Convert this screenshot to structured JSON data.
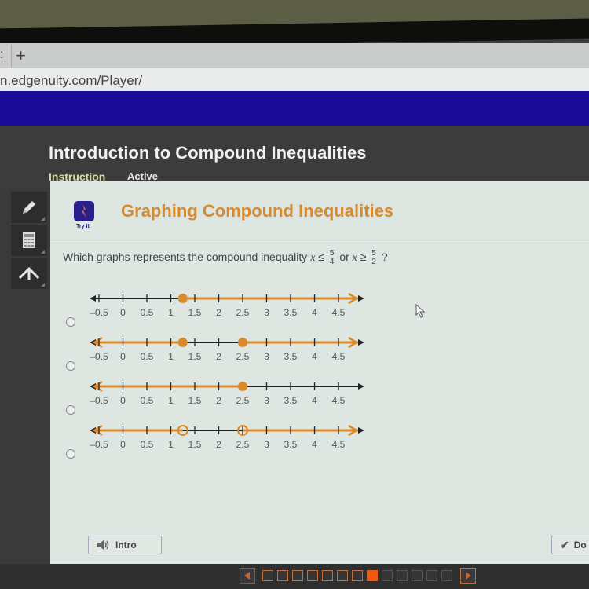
{
  "browser": {
    "tab_partial": ":",
    "new_tab_symbol": "+",
    "url": "n.edgenuity.com/Player/"
  },
  "header": {
    "lesson_title": "Introduction to Compound Inequalities",
    "tabs": [
      {
        "label": "Instruction",
        "active": true
      },
      {
        "label": "Active",
        "active": false
      }
    ]
  },
  "toolbar": {
    "tools": [
      {
        "name": "pencil-icon"
      },
      {
        "name": "calculator-icon"
      },
      {
        "name": "reference-icon"
      }
    ]
  },
  "content": {
    "tryit_label": "Try It",
    "section_title": "Graphing Compound Inequalities",
    "question": {
      "prefix": "Which graphs represents the compound inequality",
      "var1": "x",
      "op1": "≤",
      "frac1_num": "5",
      "frac1_den": "4",
      "connector": "or",
      "var2": "x",
      "op2": "≥",
      "frac2_num": "5",
      "frac2_den": "2",
      "suffix": "?"
    },
    "tick_labels": [
      "–0.5",
      "0",
      "0.5",
      "1",
      "1.5",
      "2",
      "2.5",
      "3",
      "3.5",
      "4",
      "4.5"
    ],
    "options": [
      {
        "id": "A",
        "selected": false,
        "points": [
          {
            "value": 1.25,
            "closed": true
          }
        ],
        "shaded": [
          {
            "from": 1.25,
            "to": "inf"
          }
        ]
      },
      {
        "id": "B",
        "selected": false,
        "points": [
          {
            "value": 1.25,
            "closed": true
          },
          {
            "value": 2.5,
            "closed": true
          }
        ],
        "shaded": [
          {
            "from": "-inf",
            "to": 1.25
          },
          {
            "from": 2.5,
            "to": "inf"
          }
        ]
      },
      {
        "id": "C",
        "selected": false,
        "points": [
          {
            "value": 2.5,
            "closed": true
          }
        ],
        "shaded": [
          {
            "from": "-inf",
            "to": 2.5
          }
        ]
      },
      {
        "id": "D",
        "selected": false,
        "points": [
          {
            "value": 1.25,
            "closed": false
          },
          {
            "value": 2.5,
            "closed": false
          }
        ],
        "shaded": [
          {
            "from": "-inf",
            "to": 1.25
          },
          {
            "from": 2.5,
            "to": "inf"
          }
        ]
      }
    ]
  },
  "buttons": {
    "intro_label": "Intro",
    "done_label": "Do"
  },
  "navigation": {
    "total_pages": 13,
    "completed_pages": 7,
    "current_page": 8
  },
  "colors": {
    "accent_orange": "#d98a2c",
    "nav_current": "#ee5a10",
    "header_blue": "#1c0c9a",
    "tryit_purple": "#2b1f8e"
  }
}
